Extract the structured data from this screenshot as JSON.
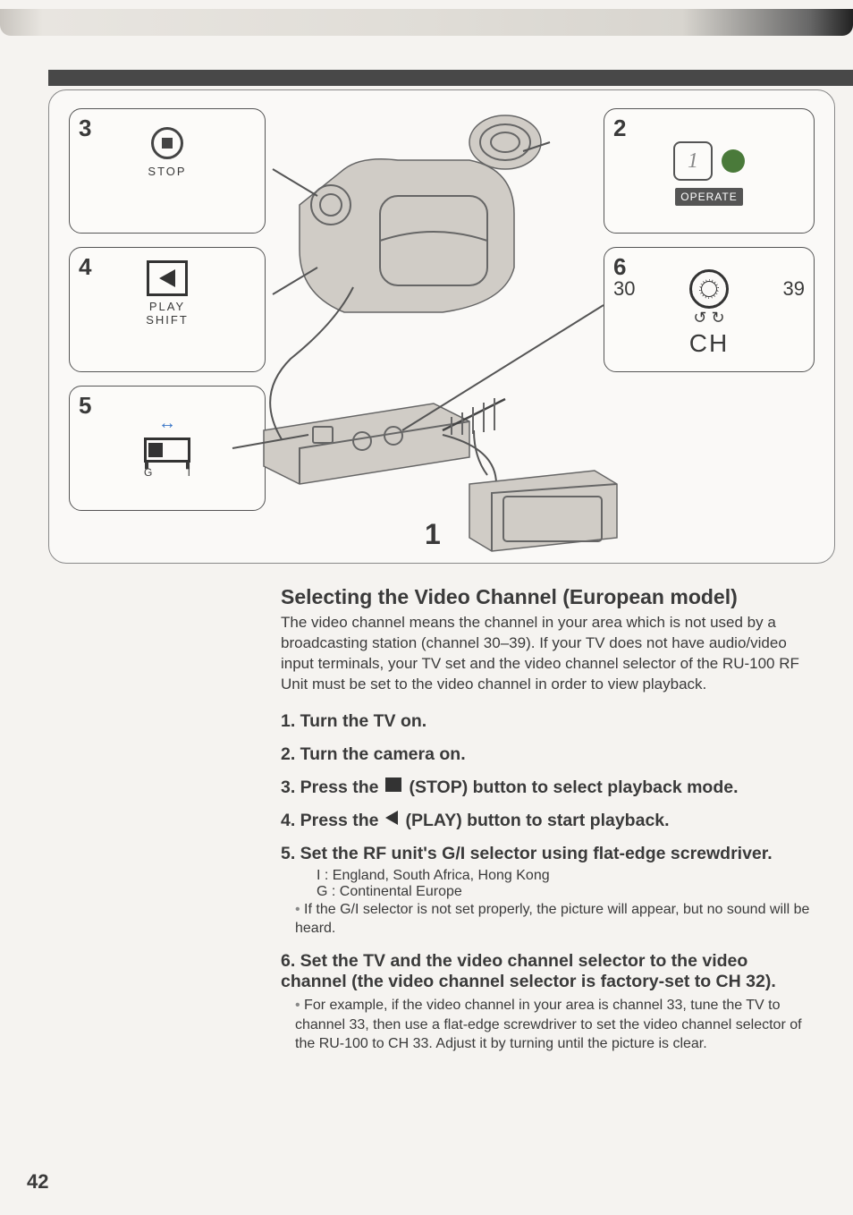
{
  "page_number": "42",
  "diagram": {
    "callout2": {
      "num": "2",
      "operate": "OPERATE",
      "one": "1"
    },
    "callout3": {
      "num": "3",
      "label": "STOP"
    },
    "callout4": {
      "num": "4",
      "label_line1": "PLAY",
      "label_line2": "SHIFT"
    },
    "callout5": {
      "num": "5",
      "g": "G",
      "i": "I"
    },
    "callout6": {
      "num": "6",
      "left": "30",
      "right": "39",
      "ch": "CH"
    },
    "tv_label": "1"
  },
  "section_title": "Selecting the Video Channel (European model)",
  "intro": "The video channel means the channel in your area which is not used by a broadcasting station (channel 30–39). If your TV does not have audio/video input terminals, your TV set and the video channel selector of the RU-100 RF Unit must be set to the video channel in order to view playback.",
  "steps": {
    "s1": "1. Turn the TV on.",
    "s2": "2. Turn the camera on.",
    "s3_a": "3. Press the ",
    "s3_b": " (STOP) button to select playback mode.",
    "s4_a": "4. Press the ",
    "s4_b": " (PLAY) button to start playback.",
    "s5": "5. Set the RF unit's G/I selector using flat-edge screwdriver.",
    "s5_i": "I : England, South Africa, Hong Kong",
    "s5_g": "G : Continental Europe",
    "s5_note": "If the G/I selector is not set properly, the picture will appear, but no sound will be heard.",
    "s6": "6. Set the TV and the video channel selector to the video channel (the video channel selector is factory-set to CH 32).",
    "s6_note": "For example, if the video channel in your area is channel 33, tune the TV to channel 33, then use a flat-edge screwdriver to set the video channel selector of the RU-100 to CH 33. Adjust it by turning until the picture is clear."
  }
}
